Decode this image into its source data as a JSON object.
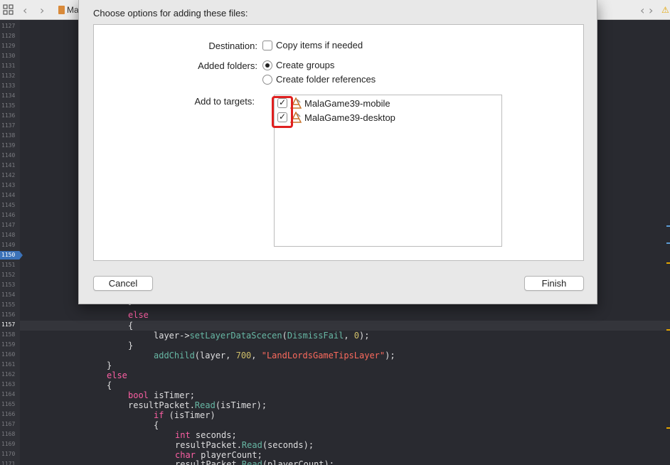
{
  "editor": {
    "breadcrumb": "Ma",
    "line_numbers": [
      "1127",
      "1128",
      "1129",
      "1130",
      "1131",
      "1132",
      "1133",
      "1134",
      "1135",
      "1136",
      "1137",
      "1138",
      "1139",
      "1140",
      "1141",
      "1142",
      "1143",
      "1144",
      "1145",
      "1146",
      "1147",
      "1148",
      "1149",
      "1150",
      "1151",
      "1152",
      "1153",
      "1154",
      "1155",
      "1156",
      "1157",
      "1158",
      "1159",
      "1160",
      "1161",
      "1162",
      "1163",
      "1164",
      "1165",
      "1166",
      "1167",
      "1168",
      "1169",
      "1170",
      "1171"
    ],
    "current_line": "1157",
    "breakpoint_line": "1150",
    "code": {
      "l1155": "}",
      "l1156_kw": "else",
      "l1157": "{",
      "l1158_a": "layer->",
      "l1158_fn": "setLayerDataScecen",
      "l1158_b": "(",
      "l1158_fn2": "DismissFail",
      "l1158_c": ", ",
      "l1158_num": "0",
      "l1158_d": ");",
      "l1159": "}",
      "l1160_fn": "addChild",
      "l1160_a": "(layer, ",
      "l1160_num": "700",
      "l1160_b": ", ",
      "l1160_str": "\"LandLordsGameTipsLayer\"",
      "l1160_c": ");",
      "l1161": "}",
      "l1162_kw": "else",
      "l1163": "{",
      "l1164_kw": "bool",
      "l1164_a": " isTimer;",
      "l1165_a": "resultPacket.",
      "l1165_fn": "Read",
      "l1165_b": "(isTimer);",
      "l1166_kw": "if",
      "l1166_a": " (isTimer)",
      "l1167": "{",
      "l1168_kw": "int",
      "l1168_a": " seconds;",
      "l1169_a": "resultPacket.",
      "l1169_fn": "Read",
      "l1169_b": "(seconds);",
      "l1170_kw": "char",
      "l1170_a": " playerCount;",
      "l1171_a": "resultPacket.",
      "l1171_fn": "Read",
      "l1171_b": "(playerCount);"
    }
  },
  "dialog": {
    "title": "Choose options for adding these files:",
    "destination_label": "Destination:",
    "copy_items_label": "Copy items if needed",
    "copy_items_checked": false,
    "added_folders_label": "Added folders:",
    "create_groups_label": "Create groups",
    "create_folder_refs_label": "Create folder references",
    "selected_folder_option": "Create groups",
    "add_to_targets_label": "Add to targets:",
    "targets": [
      {
        "name": "MalaGame39-mobile",
        "checked": true,
        "icon": "app-target-icon"
      },
      {
        "name": "MalaGame39-desktop",
        "checked": true,
        "icon": "app-target-icon"
      }
    ],
    "cancel_label": "Cancel",
    "finish_label": "Finish"
  },
  "colors": {
    "highlight": "#e02020",
    "editor_bg": "#292a30",
    "keyword": "#fc5fa3",
    "function": "#67b7a4",
    "number": "#d0bf69",
    "string": "#fc6a5d"
  }
}
